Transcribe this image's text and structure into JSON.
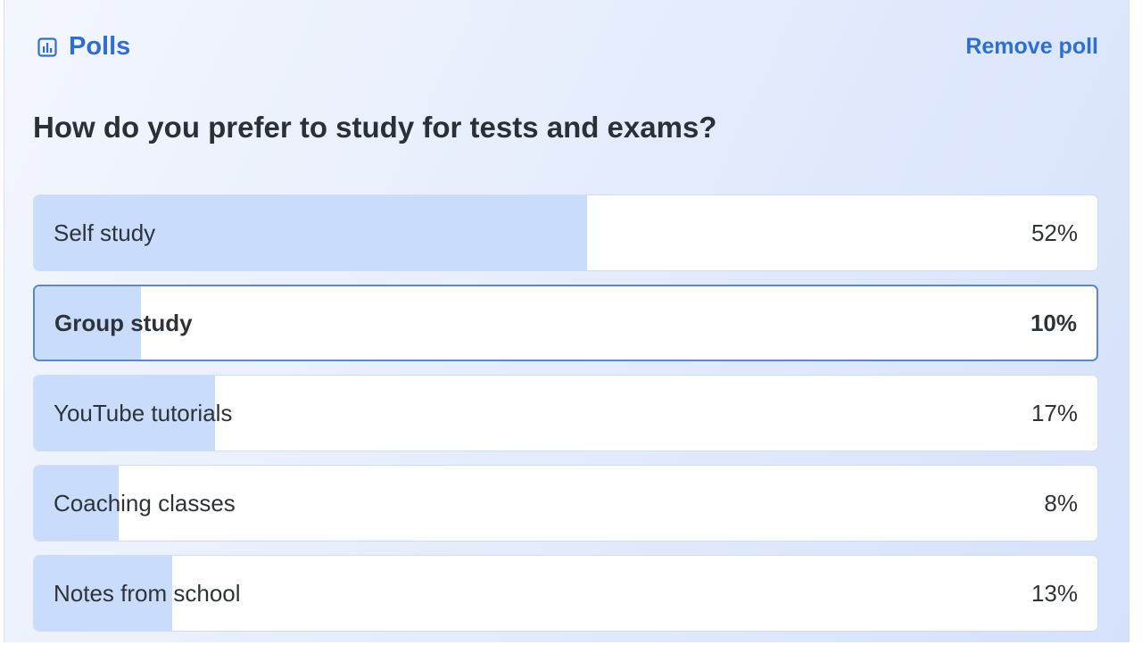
{
  "header": {
    "title": "Polls",
    "icon": "bar-chart-icon",
    "remove_label": "Remove poll",
    "accent_color": "#2f6fd1"
  },
  "poll": {
    "question": "How do you prefer to study for tests and exams?",
    "options": [
      {
        "label": "Self study",
        "percent_text": "52%",
        "percent": 52,
        "selected": false
      },
      {
        "label": "Group study",
        "percent_text": "10%",
        "percent": 10,
        "selected": true
      },
      {
        "label": "YouTube tutorials",
        "percent_text": "17%",
        "percent": 17,
        "selected": false
      },
      {
        "label": "Coaching classes",
        "percent_text": "8%",
        "percent": 8,
        "selected": false
      },
      {
        "label": "Notes from school",
        "percent_text": "13%",
        "percent": 13,
        "selected": false
      }
    ],
    "fill_color": "#c9dcfb"
  }
}
